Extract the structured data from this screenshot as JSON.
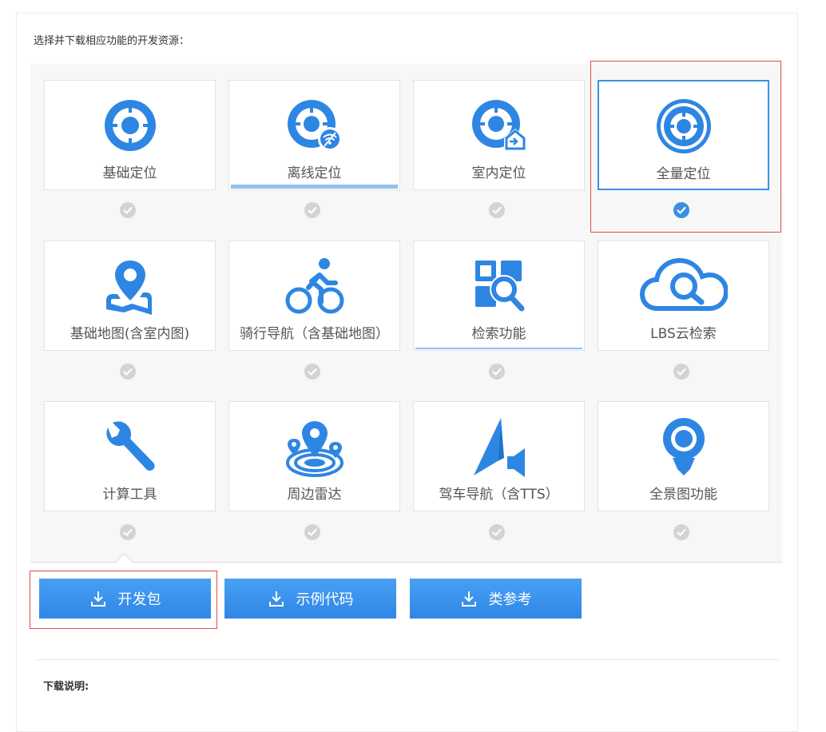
{
  "instruction": "选择并下载相应功能的开发资源：",
  "modules": [
    {
      "label": "基础定位",
      "icon": "location-target-icon",
      "checked": false
    },
    {
      "label": "离线定位",
      "icon": "offline-location-icon",
      "checked": false
    },
    {
      "label": "室内定位",
      "icon": "indoor-location-icon",
      "checked": false
    },
    {
      "label": "全量定位",
      "icon": "full-location-icon",
      "checked": true
    },
    {
      "label": "基础地图(含室内图)",
      "icon": "base-map-icon",
      "checked": false
    },
    {
      "label": "骑行导航（含基础地图）",
      "icon": "cycling-icon",
      "checked": false
    },
    {
      "label": "检索功能",
      "icon": "search-icon",
      "checked": false
    },
    {
      "label": "LBS云检索",
      "icon": "cloud-search-icon",
      "checked": false
    },
    {
      "label": "计算工具",
      "icon": "wrench-icon",
      "checked": false
    },
    {
      "label": "周边雷达",
      "icon": "radar-icon",
      "checked": false
    },
    {
      "label": "驾车导航（含TTS）",
      "icon": "driving-navigation-icon",
      "checked": false
    },
    {
      "label": "全景图功能",
      "icon": "panorama-icon",
      "checked": false
    }
  ],
  "buttons": {
    "sdk": "开发包",
    "sample": "示例代码",
    "reference": "类参考"
  },
  "notes_title": "下载说明:",
  "colors": {
    "accent": "#3d8fe3",
    "icon_blue": "#2e86e3",
    "check_off": "#d3d3d3",
    "highlight_red": "#e24a4a",
    "panel_bg": "#f7f7f7"
  }
}
